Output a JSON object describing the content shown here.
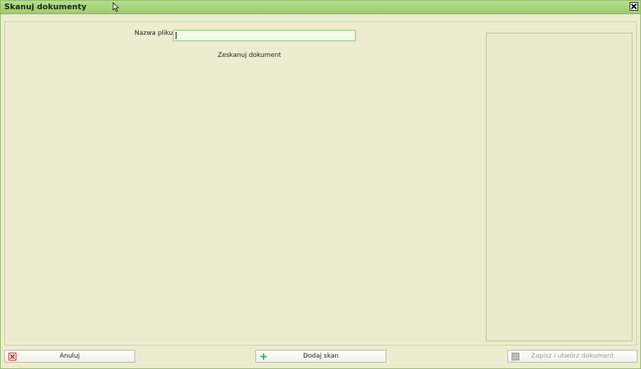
{
  "window": {
    "title": "Skanuj dokumenty"
  },
  "form": {
    "filename_label": "Nazwa pliku:",
    "filename_value": "",
    "scan_link": "Zeskanuj dokument"
  },
  "buttons": {
    "cancel_label": "Anuluj",
    "add_scan_label": "Dodaj skan",
    "save_label": "Zapisz i utwórz dokument"
  },
  "icons": {
    "close": "close-icon",
    "cancel": "cancel-x-icon",
    "add": "plus-icon",
    "save": "save-icon",
    "cursor": "mouse-cursor-icon"
  },
  "colors": {
    "titlebar": "#9ccd6d",
    "background": "#ececd0",
    "input_border": "#7ec86b",
    "cancel_icon": "#d02020",
    "add_icon": "#3aa33a"
  }
}
